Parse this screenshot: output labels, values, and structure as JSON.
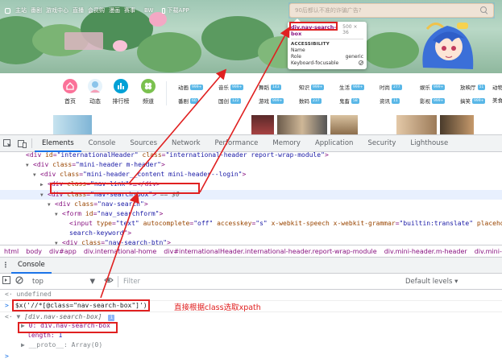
{
  "site": {
    "top_nav": [
      "主站",
      "番剧",
      "游戏中心",
      "直播",
      "会员购",
      "漫画",
      "赛事",
      "BW"
    ],
    "download_app": "下载APP",
    "search_placeholder": "90后都认不准的诈骗广告?",
    "nav_icons": [
      {
        "label": "首页",
        "color": "#fb7299",
        "icon": "home-icon"
      },
      {
        "label": "动态",
        "color": "#8bc4ea",
        "icon": "avatar-icon"
      },
      {
        "label": "排行榜",
        "color": "#00a1d6",
        "icon": "chart-icon"
      },
      {
        "label": "频道",
        "color": "#7bc14f",
        "icon": "channel-icon"
      }
    ],
    "nav_grid": [
      {
        "label": "动画",
        "badge": "999+"
      },
      {
        "label": "音乐",
        "badge": "999+"
      },
      {
        "label": "舞蹈",
        "badge": "143"
      },
      {
        "label": "知识",
        "badge": "999+"
      },
      {
        "label": "生活",
        "badge": "999+"
      },
      {
        "label": "时尚",
        "badge": "277"
      },
      {
        "label": "娱乐",
        "badge": "999+"
      },
      {
        "label": "放映厅",
        "badge": "51"
      },
      {
        "label": "番剧",
        "badge": "60"
      },
      {
        "label": "国创",
        "badge": "122"
      },
      {
        "label": "游戏",
        "badge": "999+"
      },
      {
        "label": "数码",
        "badge": "237"
      },
      {
        "label": "鬼畜",
        "badge": "58"
      },
      {
        "label": "资讯",
        "badge": "11"
      },
      {
        "label": "影视",
        "badge": "999+"
      },
      {
        "label": "搞笑",
        "badge": "999+"
      }
    ],
    "nav_extra_row1": "动物",
    "nav_extra_row2": "美食"
  },
  "tooltip": {
    "selector": "div.nav-search-box",
    "size": "500 × 36",
    "section": "ACCESSIBILITY",
    "rows": [
      {
        "label": "Name",
        "value": ""
      },
      {
        "label": "Role",
        "value": "generic"
      },
      {
        "label": "Keyboard-focusable",
        "value": ""
      }
    ]
  },
  "devtools": {
    "tabs": [
      "Elements",
      "Console",
      "Sources",
      "Network",
      "Performance",
      "Memory",
      "Application",
      "Security",
      "Lighthouse"
    ],
    "active_tab": "Elements",
    "dom_lines": [
      {
        "indent": 1,
        "tri": "",
        "tag": "div",
        "attrs": [
          [
            "id",
            "internationalHeader"
          ],
          [
            "class",
            "international-header report-wrap-module"
          ]
        ],
        "close": ">"
      },
      {
        "indent": 2,
        "tri": "▼",
        "tag": "div",
        "attrs": [
          [
            "class",
            "mini-header m-header"
          ]
        ],
        "close": ">"
      },
      {
        "indent": 3,
        "tri": "▼",
        "tag": "div",
        "attrs": [
          [
            "class",
            "mini-header__content mini-header--login"
          ]
        ],
        "close": ">"
      },
      {
        "indent": 4,
        "tri": "▶",
        "tag": "div",
        "attrs": [
          [
            "class",
            "nav-link"
          ]
        ],
        "close": ">…</div>"
      },
      {
        "indent": 4,
        "tri": "▼",
        "tag": "div",
        "attrs": [
          [
            "class",
            "nav-search-box"
          ]
        ],
        "close": ">",
        "suffix": " == $0",
        "selected": true
      },
      {
        "indent": 5,
        "tri": "▼",
        "tag": "div",
        "attrs": [
          [
            "class",
            "nav-search"
          ]
        ],
        "close": ">"
      },
      {
        "indent": 6,
        "tri": "▼",
        "tag": "form",
        "attrs": [
          [
            "id",
            "nav_searchform"
          ]
        ],
        "close": ">"
      },
      {
        "indent": 7,
        "tri": "",
        "tag": "input",
        "attrs": [
          [
            "type",
            "text"
          ],
          [
            "autocomplete",
            "off"
          ],
          [
            "accesskey",
            "s"
          ],
          [
            "x-webkit-speech",
            ""
          ],
          [
            "x-webkit-grammar",
            "builtin:translate"
          ],
          [
            "placeholder",
            ""
          ]
        ],
        "close": ""
      },
      {
        "indent": 7,
        "tri": "",
        "raw": "search-keyword\">"
      },
      {
        "indent": 6,
        "tri": "▼",
        "tag": "div",
        "attrs": [
          [
            "class",
            "nav-search-btn"
          ]
        ],
        "close": ">"
      }
    ],
    "breadcrumbs": [
      "html",
      "body",
      "div#app",
      "div.international-home",
      "div#internationalHeader.international-header.report-wrap-module",
      "div.mini-header.m-header",
      "div.mini-header__content.mini-header--login",
      "div.nav-search-box"
    ],
    "console_tab": "Console",
    "context": "top",
    "filter_placeholder": "Filter",
    "levels": "Default levels ▾",
    "console_lines": {
      "undefined": "undefined",
      "input": "$x('//*[@class=\"nav-search-box\"]')",
      "result_head": "[div.nav-search-box]",
      "item_index": "0:",
      "item_value": "div.nav-search-box",
      "length_key": "length:",
      "length_val": "1",
      "proto": "__proto__: Array(0)"
    }
  },
  "annotation": "直接根据class选取xpath",
  "colors": {
    "accent_red": "#e02020",
    "devtools_blue": "#1a73e8",
    "tag_purple": "#881280",
    "attr_orange": "#994500",
    "value_blue": "#1a1aa6"
  }
}
